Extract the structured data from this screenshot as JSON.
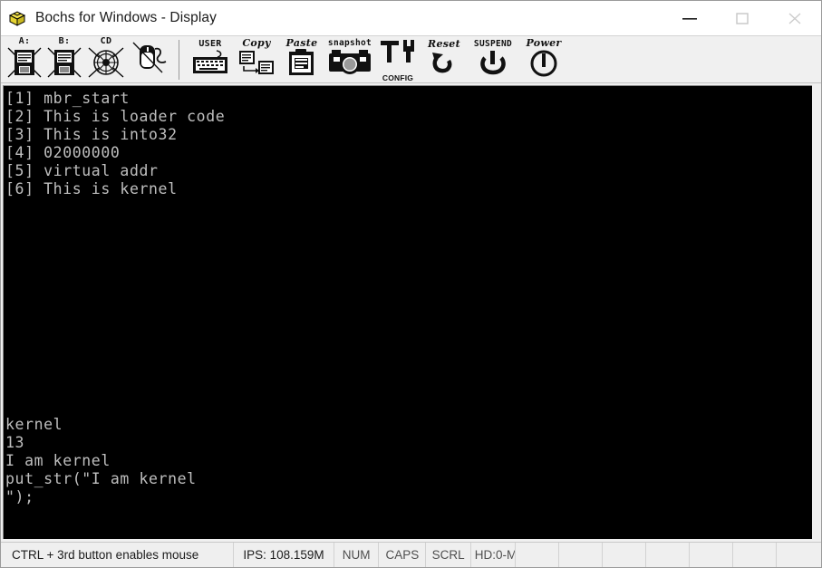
{
  "window": {
    "title": "Bochs for Windows - Display",
    "icon": "bochs-box-icon",
    "controls": [
      {
        "name": "minimize-button",
        "glyph": "minimize-icon"
      },
      {
        "name": "maximize-button",
        "glyph": "maximize-icon"
      },
      {
        "name": "close-button",
        "glyph": "close-icon"
      }
    ]
  },
  "toolbar": {
    "buttons": [
      {
        "name": "floppy-a-button",
        "label": "A:",
        "icon": "floppy-disk-a-icon"
      },
      {
        "name": "floppy-b-button",
        "label": "B:",
        "icon": "floppy-disk-b-icon"
      },
      {
        "name": "cdrom-button",
        "label": "CD",
        "icon": "cdrom-disc-icon"
      },
      {
        "name": "mouse-button",
        "label": "",
        "icon": "mouse-disabled-icon"
      },
      {
        "name": "user-button",
        "label": "USER",
        "icon": "keyboard-icon"
      },
      {
        "name": "copy-button",
        "label": "Copy",
        "icon": "copy-icon"
      },
      {
        "name": "paste-button",
        "label": "Paste",
        "icon": "paste-icon"
      },
      {
        "name": "snapshot-button",
        "label": "snapshot",
        "icon": "camera-icon"
      },
      {
        "name": "config-button",
        "label": "CONFIG",
        "icon": "tools-icon"
      },
      {
        "name": "reset-button",
        "label": "Reset",
        "icon": "reset-arrow-icon"
      },
      {
        "name": "suspend-button",
        "label": "SUSPEND",
        "icon": "suspend-icon"
      },
      {
        "name": "power-button",
        "label": "Power",
        "icon": "power-icon"
      }
    ]
  },
  "screen": {
    "background_color": "#000000",
    "text_color": "#bfbfbf",
    "top_lines": "[1] mbr_start\n[2] This is loader code\n[3] This is into32\n[4] 02000000\n[5] virtual addr\n[6] This is kernel",
    "bottom_lines": "kernel\n13\nI am kernel\nput_str(\"I am kernel\n\");"
  },
  "statusbar": {
    "message": "CTRL + 3rd button enables mouse",
    "ips": "IPS: 108.159M",
    "indicators": [
      "NUM",
      "CAPS",
      "SCRL"
    ],
    "hd": "HD:0-M",
    "empty_cells": 7
  }
}
